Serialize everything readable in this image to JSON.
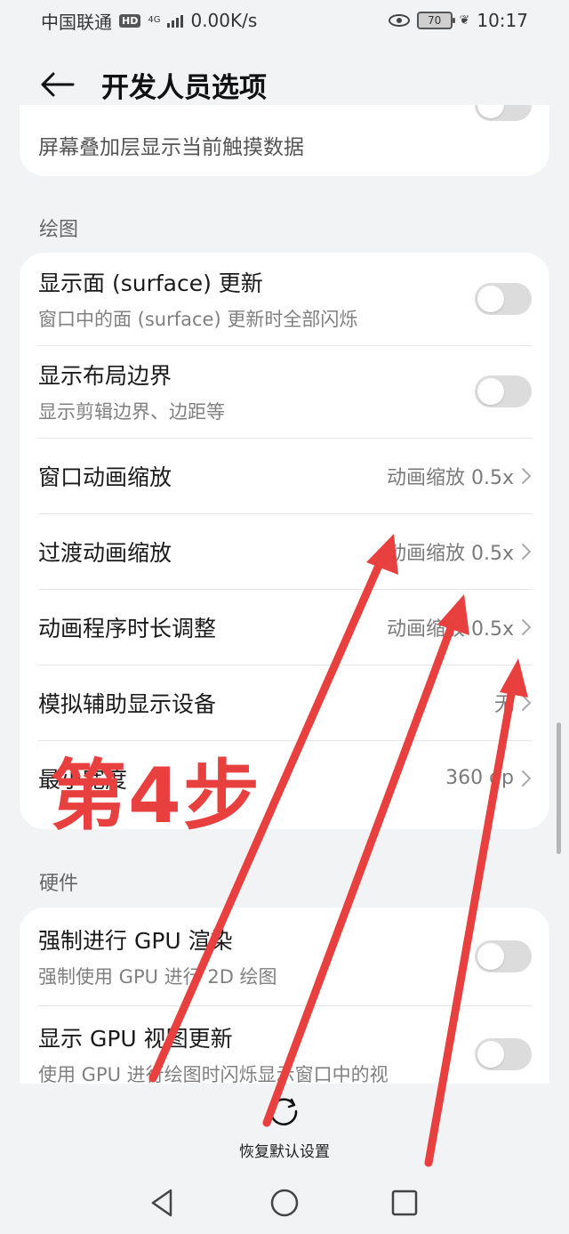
{
  "status_bar": {
    "carrier": "中国联通",
    "hd_badge": "HD",
    "network_type": "4G",
    "speed": "0.00K/s",
    "battery_level": "70",
    "time": "10:17"
  },
  "header": {
    "title": "开发人员选项"
  },
  "top_partial_item": {
    "subtitle": "屏幕叠加层显示当前触摸数据",
    "toggle_on": false
  },
  "sections": {
    "drawing": {
      "label": "绘图",
      "items": [
        {
          "title": "显示面 (surface) 更新",
          "subtitle": "窗口中的面 (surface) 更新时全部闪烁",
          "toggle_on": false
        },
        {
          "title": "显示布局边界",
          "subtitle": "显示剪辑边界、边距等",
          "toggle_on": false
        },
        {
          "title": "窗口动画缩放",
          "value": "动画缩放 0.5x"
        },
        {
          "title": "过渡动画缩放",
          "value": "动画缩放 0.5x"
        },
        {
          "title": "动画程序时长调整",
          "value": "动画缩放 0.5x"
        },
        {
          "title": "模拟辅助显示设备",
          "value": "无"
        },
        {
          "title": "最小宽度",
          "value": "360 dp"
        }
      ]
    },
    "hardware": {
      "label": "硬件",
      "items": [
        {
          "title": "强制进行 GPU 渲染",
          "subtitle": "强制使用 GPU 进行 2D 绘图",
          "toggle_on": false
        },
        {
          "title": "显示 GPU 视图更新",
          "subtitle": "使用 GPU 进行绘图时闪烁显示窗口中的视",
          "toggle_on": false
        }
      ]
    }
  },
  "footer": {
    "reset_label": "恢复默认设置"
  },
  "annotation": {
    "step_label": "第4步",
    "color": "#e8403f"
  },
  "colors": {
    "background": "#f1f3f5",
    "card": "#ffffff",
    "toggle_off": "#dcdcdc",
    "annotation_red": "#e8403f"
  }
}
